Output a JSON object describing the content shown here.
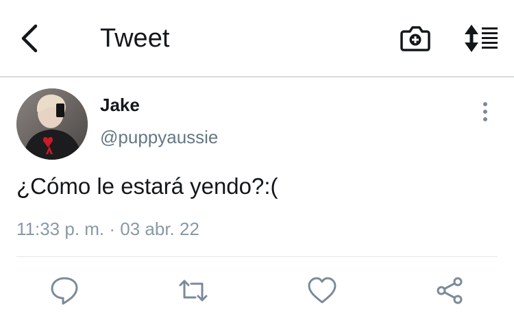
{
  "header": {
    "title": "Tweet",
    "back_icon": "chevron-left-icon",
    "camera_icon": "camera-plus-icon",
    "sort_icon": "sort-list-icon"
  },
  "tweet": {
    "author_name": "Jake",
    "author_handle": "@puppyaussie",
    "text": "¿Cómo le estará yendo?:(",
    "timestamp": "11:33 p. m. · 03 abr. 22"
  },
  "actions": {
    "reply_icon": "comment-icon",
    "retweet_icon": "retweet-icon",
    "like_icon": "heart-icon",
    "share_icon": "share-icon",
    "more_icon": "more-vertical-icon"
  },
  "colors": {
    "primary_text": "#14171a",
    "secondary_text": "#657786",
    "meta_text": "#8899a6",
    "action_icon": "#7a8a99",
    "divider": "#e1e8ed"
  }
}
